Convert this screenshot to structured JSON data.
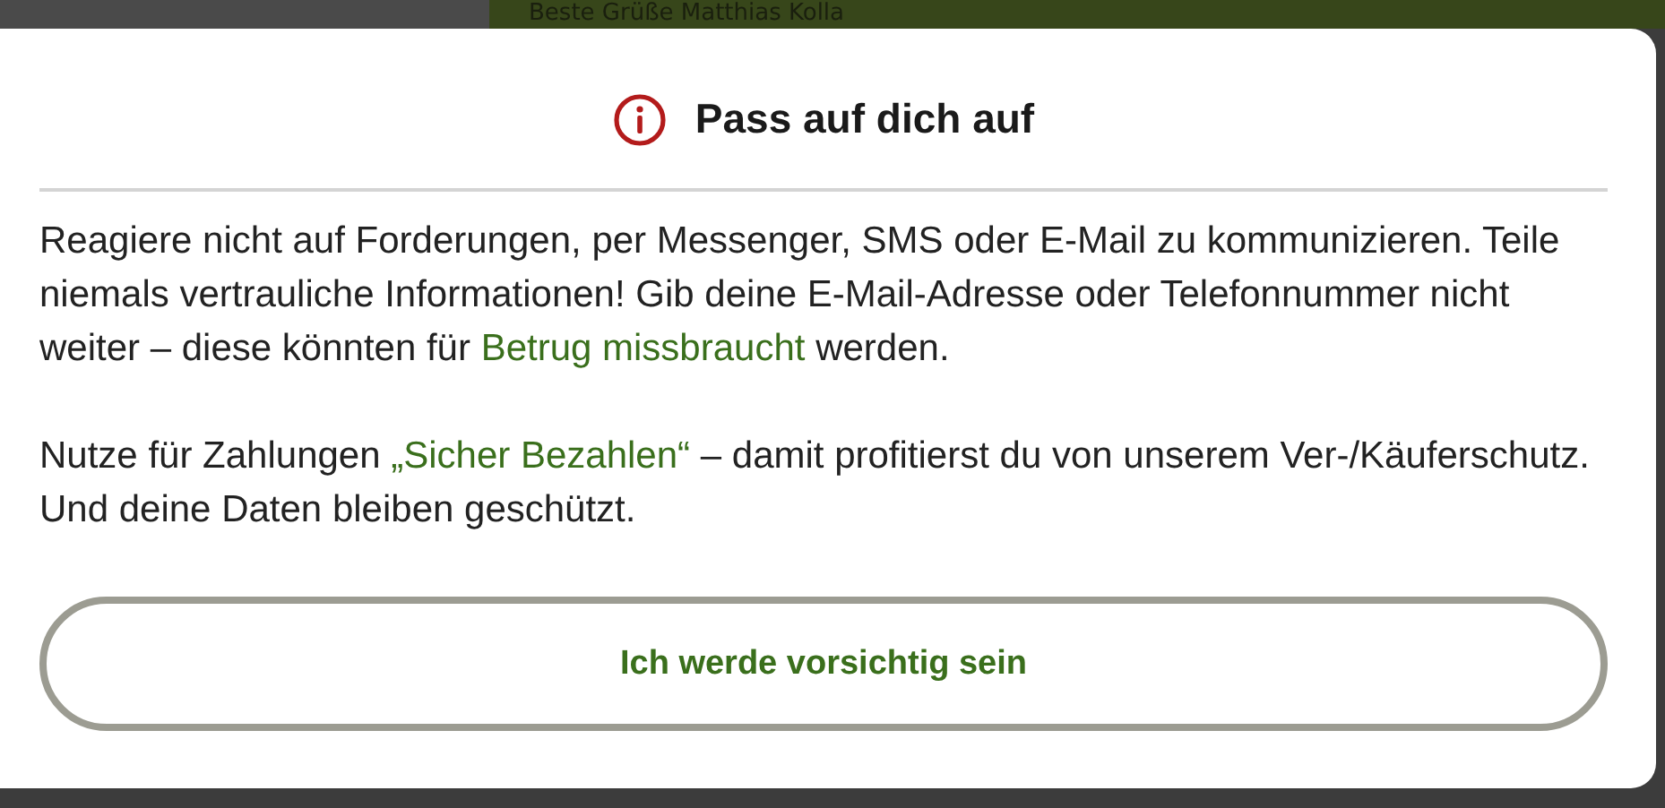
{
  "background": {
    "greeting": "Beste Grüße Matthias Kolla"
  },
  "dialog": {
    "title": "Pass auf dich auf",
    "paragraphs": [
      {
        "parts": [
          {
            "kind": "text",
            "text": "Reagiere nicht auf Forderungen, per Messenger, SMS oder E-Mail zu kommunizieren. Teile niemals vertrauliche Informationen! Gib deine E-Mail-Adresse oder Telefonnummer nicht weiter – diese könnten für "
          },
          {
            "kind": "link",
            "text": "Betrug missbraucht"
          },
          {
            "kind": "text",
            "text": " werden."
          }
        ]
      },
      {
        "parts": [
          {
            "kind": "text",
            "text": "Nutze für Zahlungen "
          },
          {
            "kind": "link",
            "text": "„Sicher Bezahlen“"
          },
          {
            "kind": "text",
            "text": " – damit profitierst du von unserem Ver-/Käuferschutz. Und deine Daten bleiben geschützt."
          }
        ]
      }
    ],
    "button": "Ich werde vorsichtig sein"
  }
}
